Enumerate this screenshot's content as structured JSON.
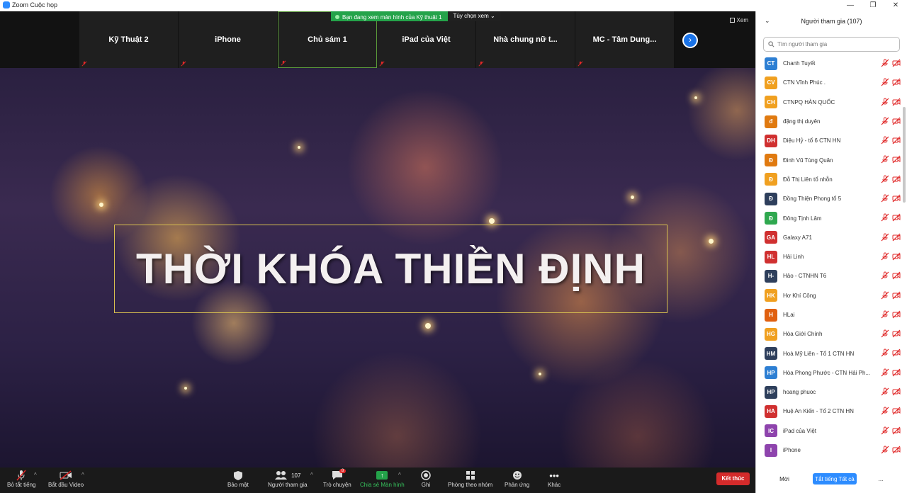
{
  "window": {
    "title": "Zoom Cuộc họp",
    "controls": [
      "—",
      "❐",
      "✕"
    ]
  },
  "share_banner": {
    "message": "Bạn đang xem màn hình của Kỹ thuật 1",
    "view_options": "Tùy chọn xem"
  },
  "thumbnails": [
    {
      "name": "Kỹ Thuật 2"
    },
    {
      "name": "iPhone"
    },
    {
      "name": "Chủ sám 1"
    },
    {
      "name": "iPad của Việt"
    },
    {
      "name": "Nhà chung nữ t..."
    },
    {
      "name": "MC - Tâm Dung..."
    }
  ],
  "view_button": "Xem",
  "shared_content": {
    "title": "THỜI KHÓA THIỀN ĐỊNH"
  },
  "toolbar": {
    "mute_all": "Bỏ tắt tiếng",
    "start_video": "Bắt đầu Video",
    "security": "Bảo mật",
    "participants": "Người tham gia",
    "participants_count": "107",
    "chat": "Trò chuyện",
    "chat_badge": "8",
    "share_screen": "Chia sẻ Màn hình",
    "record": "Ghi",
    "breakout": "Phòng theo nhóm",
    "reactions": "Phản ứng",
    "more": "Khác",
    "end": "Kết thúc"
  },
  "panel": {
    "title": "Người tham gia (107)",
    "search_placeholder": "Tìm người tham gia",
    "participants": [
      {
        "initials": "CT",
        "name": "Chanh Tuyết",
        "color": "#2d7fd3"
      },
      {
        "initials": "CV",
        "name": "CTN Vĩnh Phúc .",
        "color": "#f0a020"
      },
      {
        "initials": "CH",
        "name": "CTNPQ HÀN QUỐC",
        "color": "#f0a020"
      },
      {
        "initials": "đ",
        "name": "đặng thị duyên",
        "color": "#e07a10"
      },
      {
        "initials": "DH",
        "name": "Diệu Hỷ - tổ 6 CTN HN",
        "color": "#d03030"
      },
      {
        "initials": "Đ",
        "name": "Đinh Vũ Tùng Quân",
        "color": "#e07a10"
      },
      {
        "initials": "Đ",
        "name": "Đỗ Thị Liên tổ nhỗn",
        "color": "#f0a020"
      },
      {
        "initials": "Đ",
        "name": "Đồng Thiện Phong tổ 5",
        "color": "#2e3f5c"
      },
      {
        "initials": "Đ",
        "name": "Đông Tịnh Lâm",
        "color": "#2fa84f"
      },
      {
        "initials": "GA",
        "name": "Galaxy A71",
        "color": "#d03030"
      },
      {
        "initials": "HL",
        "name": "Hải Linh",
        "color": "#d03030"
      },
      {
        "initials": "H-",
        "name": "Hảo - CTNHN T6",
        "color": "#2e3f5c"
      },
      {
        "initials": "HK",
        "name": "Hơ Khí Công",
        "color": "#f0a020"
      },
      {
        "initials": "H",
        "name": "HLai",
        "color": "#e06010"
      },
      {
        "initials": "HG",
        "name": "Hòa Giới Chính",
        "color": "#f0a020"
      },
      {
        "initials": "HM",
        "name": "Hoà Mỹ Liên - Tổ 1 CTN HN",
        "color": "#2e3f5c"
      },
      {
        "initials": "HP",
        "name": "Hòa Phong Phước - CTN Hải Ph...",
        "color": "#2d7fd3"
      },
      {
        "initials": "HP",
        "name": "hoang phuoc",
        "color": "#2e3f5c"
      },
      {
        "initials": "HA",
        "name": "Huệ An Kiến - Tổ 2 CTN HN",
        "color": "#d03030"
      },
      {
        "initials": "IC",
        "name": "iPad của Việt",
        "color": "#8e44ad"
      },
      {
        "initials": "I",
        "name": "iPhone",
        "color": "#8e44ad"
      },
      {
        "initials": "",
        "name": "",
        "color": "#8e44ad"
      }
    ],
    "invite": "Mời",
    "mute_all": "Tắt tiếng Tất cả",
    "more": "..."
  }
}
